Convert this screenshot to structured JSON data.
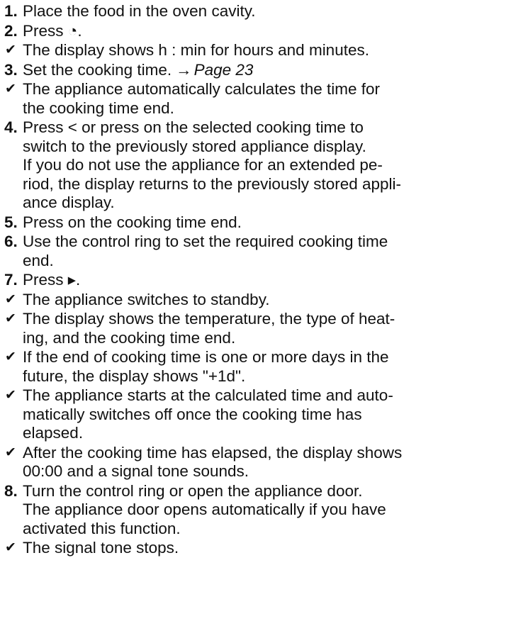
{
  "steps": [
    {
      "type": "step",
      "number": "1.",
      "lines": [
        "Place the food in the oven cavity."
      ]
    },
    {
      "type": "step",
      "number": "2.",
      "lines": [
        "Press ◔."
      ]
    },
    {
      "type": "result",
      "icon": "check-icon",
      "lines": [
        "The display shows h : min for hours and minutes."
      ]
    },
    {
      "type": "step",
      "number": "3.",
      "lines": [
        "Set the cooking time."
      ],
      "ref": {
        "arrow": "→",
        "page": "Page 23"
      }
    },
    {
      "type": "result",
      "icon": "check-icon",
      "lines": [
        "The appliance automatically calculates the time for",
        "the cooking time end."
      ]
    },
    {
      "type": "step",
      "number": "4.",
      "lines": [
        "Press < or press on the selected cooking time to",
        "switch to the previously stored appliance display.",
        "If you do not use the appliance for an extended pe-",
        "riod, the display returns to the previously stored appli-",
        "ance display."
      ]
    },
    {
      "type": "step",
      "number": "5.",
      "lines": [
        "Press on the cooking time end."
      ]
    },
    {
      "type": "step",
      "number": "6.",
      "lines": [
        "Use the control ring to set the required cooking time",
        "end."
      ]
    },
    {
      "type": "step",
      "number": "7.",
      "lines": [
        "Press ▸."
      ]
    },
    {
      "type": "result",
      "icon": "check-icon",
      "lines": [
        "The appliance switches to standby."
      ]
    },
    {
      "type": "result",
      "icon": "check-icon",
      "lines": [
        "The display shows the temperature, the type of heat-",
        "ing, and the cooking time end."
      ]
    },
    {
      "type": "result",
      "icon": "check-icon",
      "lines": [
        "If the end of cooking time is one or more days in the",
        "future, the display shows \"+1d\"."
      ]
    },
    {
      "type": "result",
      "icon": "check-icon",
      "lines": [
        "The appliance starts at the calculated time and auto-",
        "matically switches off once the cooking time has",
        "elapsed."
      ]
    },
    {
      "type": "result",
      "icon": "check-icon",
      "lines": [
        "After the cooking time has elapsed, the display shows",
        "00:00 and a signal tone sounds."
      ]
    },
    {
      "type": "step",
      "number": "8.",
      "lines": [
        "Turn the control ring or open the appliance door.",
        "The appliance door opens automatically if you have",
        "activated this function."
      ]
    },
    {
      "type": "result",
      "icon": "check-icon",
      "lines": [
        "The signal tone stops."
      ]
    }
  ]
}
